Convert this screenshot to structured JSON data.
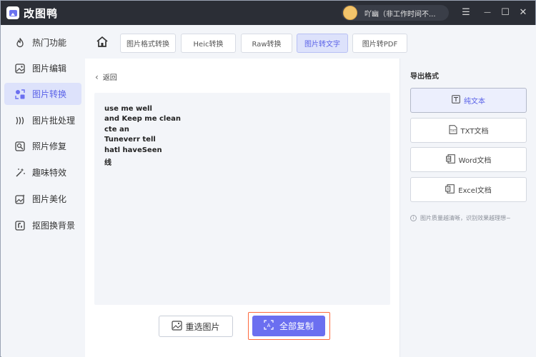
{
  "app": {
    "title": "改图鸭",
    "user_name": "吖幽（非工作时间不..."
  },
  "window_controls": {
    "menu": "☰",
    "minimize": "—",
    "maximize": "☐",
    "close": "✕"
  },
  "sidebar": {
    "items": [
      {
        "label": "热门功能",
        "icon": "fire-icon"
      },
      {
        "label": "图片编辑",
        "icon": "image-edit-icon"
      },
      {
        "label": "图片转换",
        "icon": "convert-icon"
      },
      {
        "label": "图片批处理",
        "icon": "batch-icon"
      },
      {
        "label": "照片修复",
        "icon": "photo-repair-icon"
      },
      {
        "label": "趣味特效",
        "icon": "magic-wand-icon"
      },
      {
        "label": "图片美化",
        "icon": "beautify-icon"
      },
      {
        "label": "抠图换背景",
        "icon": "cutout-icon"
      }
    ],
    "active_index": 2
  },
  "tabs": {
    "items": [
      "图片格式转换",
      "Heic转换",
      "Raw转换",
      "图片转文字",
      "图片转PDF"
    ],
    "active_index": 3
  },
  "content": {
    "back_label": "返回",
    "ocr_lines": [
      "use me well",
      "and Keep me clean",
      "cte an",
      "Tuneverr tell",
      "hatl haveSeen",
      "线"
    ],
    "reselect_label": "重选图片",
    "copy_all_label": "全部复制"
  },
  "export": {
    "title": "导出格式",
    "formats": [
      {
        "label": "纯文本",
        "icon": "text-icon"
      },
      {
        "label": "TXT文档",
        "icon": "txt-file-icon"
      },
      {
        "label": "Word文档",
        "icon": "word-file-icon"
      },
      {
        "label": "Excel文档",
        "icon": "excel-file-icon"
      }
    ],
    "active_index": 0,
    "hint": "图片质量越清晰，识别效果越理想~"
  },
  "colors": {
    "accent": "#6b6ff0",
    "highlight_border": "#ff6a3d",
    "titlebar": "#2b2e36"
  }
}
